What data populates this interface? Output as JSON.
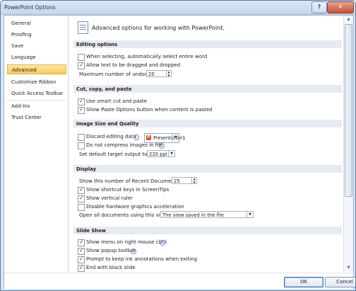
{
  "window": {
    "title": "PowerPoint Options",
    "help_glyph": "?",
    "close_glyph": "✕"
  },
  "nav": {
    "items": [
      "General",
      "Proofing",
      "Save",
      "Language",
      "Advanced",
      "Customize Ribbon",
      "Quick Access Toolbar",
      "Add-Ins",
      "Trust Center"
    ],
    "selected": "Advanced"
  },
  "header": {
    "text": "Advanced options for working with PowerPoint."
  },
  "sections": {
    "editing": {
      "title": "Editing options",
      "select_entire_word": "When selecting, automatically select entire word",
      "drag_drop": "Allow text to be dragged and dropped",
      "undo_label": "Maximum number of undos:",
      "undo_value": "20"
    },
    "cut_copy": {
      "title": "Cut, copy, and paste",
      "smart_cut": "Use smart cut and paste",
      "paste_options": "Show Paste Options button when content is pasted"
    },
    "image": {
      "title": "Image Size and Quality",
      "presentation": "Presentation1",
      "discard": "Discard editing data",
      "no_compress": "Do not compress images in file",
      "target_label": "Set default target output to:",
      "target_value": "220 ppi"
    },
    "display": {
      "title": "Display",
      "recent_label": "Show this number of Recent Documents:",
      "recent_value": "25",
      "shortcut_keys": "Show shortcut keys in ScreenTips",
      "vertical_ruler": "Show vertical ruler",
      "hw_accel": "Disable hardware graphics acceleration",
      "open_label": "Open all documents using this view",
      "open_value": "The view saved in the file"
    },
    "slideshow": {
      "title": "Slide Show",
      "right_click_menu": "Show menu on right mouse click",
      "popup_toolbar": "Show popup toolbar",
      "keep_ink": "Prompt to keep ink annotations when exiting",
      "black_slide": "End with black slide"
    }
  },
  "footer": {
    "ok": "OK",
    "cancel": "Cancel"
  },
  "checks": {
    "select_entire_word": false,
    "drag_drop": true,
    "smart_cut": true,
    "paste_options": true,
    "discard": false,
    "no_compress": false,
    "shortcut_keys": true,
    "vertical_ruler": true,
    "hw_accel": false,
    "right_click_menu": true,
    "popup_toolbar": true,
    "keep_ink": true,
    "black_slide": true
  },
  "icons": {
    "check": "✓",
    "info": "i",
    "dropdown": "▼",
    "spin_up": "▲",
    "spin_down": "▼",
    "ppt": "P"
  }
}
